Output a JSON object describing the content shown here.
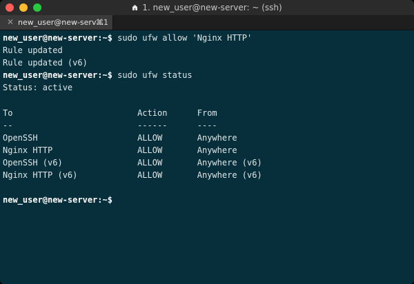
{
  "window": {
    "title": "1. new_user@new-server: ~ (ssh)",
    "title_icon": "home-icon",
    "background": "#062f3b"
  },
  "tab": {
    "label": "new_user@new-serv…",
    "shortcut": "⌘1",
    "close_glyph": "✕"
  },
  "terminal": {
    "lines": [
      {
        "prompt": "new_user@new-server:~$",
        "text": " sudo ufw allow 'Nginx HTTP'"
      },
      {
        "prompt": "",
        "text": "Rule updated"
      },
      {
        "prompt": "",
        "text": "Rule updated (v6)"
      },
      {
        "prompt": "new_user@new-server:~$",
        "text": " sudo ufw status"
      },
      {
        "prompt": "",
        "text": "Status: active"
      },
      {
        "prompt": "",
        "text": ""
      },
      {
        "prompt": "",
        "text": "To                         Action      From"
      },
      {
        "prompt": "",
        "text": "--                         ------      ----"
      },
      {
        "prompt": "",
        "text": "OpenSSH                    ALLOW       Anywhere"
      },
      {
        "prompt": "",
        "text": "Nginx HTTP                 ALLOW       Anywhere"
      },
      {
        "prompt": "",
        "text": "OpenSSH (v6)               ALLOW       Anywhere (v6)"
      },
      {
        "prompt": "",
        "text": "Nginx HTTP (v6)            ALLOW       Anywhere (v6)"
      },
      {
        "prompt": "",
        "text": ""
      },
      {
        "prompt": "new_user@new-server:~$",
        "text": ""
      }
    ]
  }
}
